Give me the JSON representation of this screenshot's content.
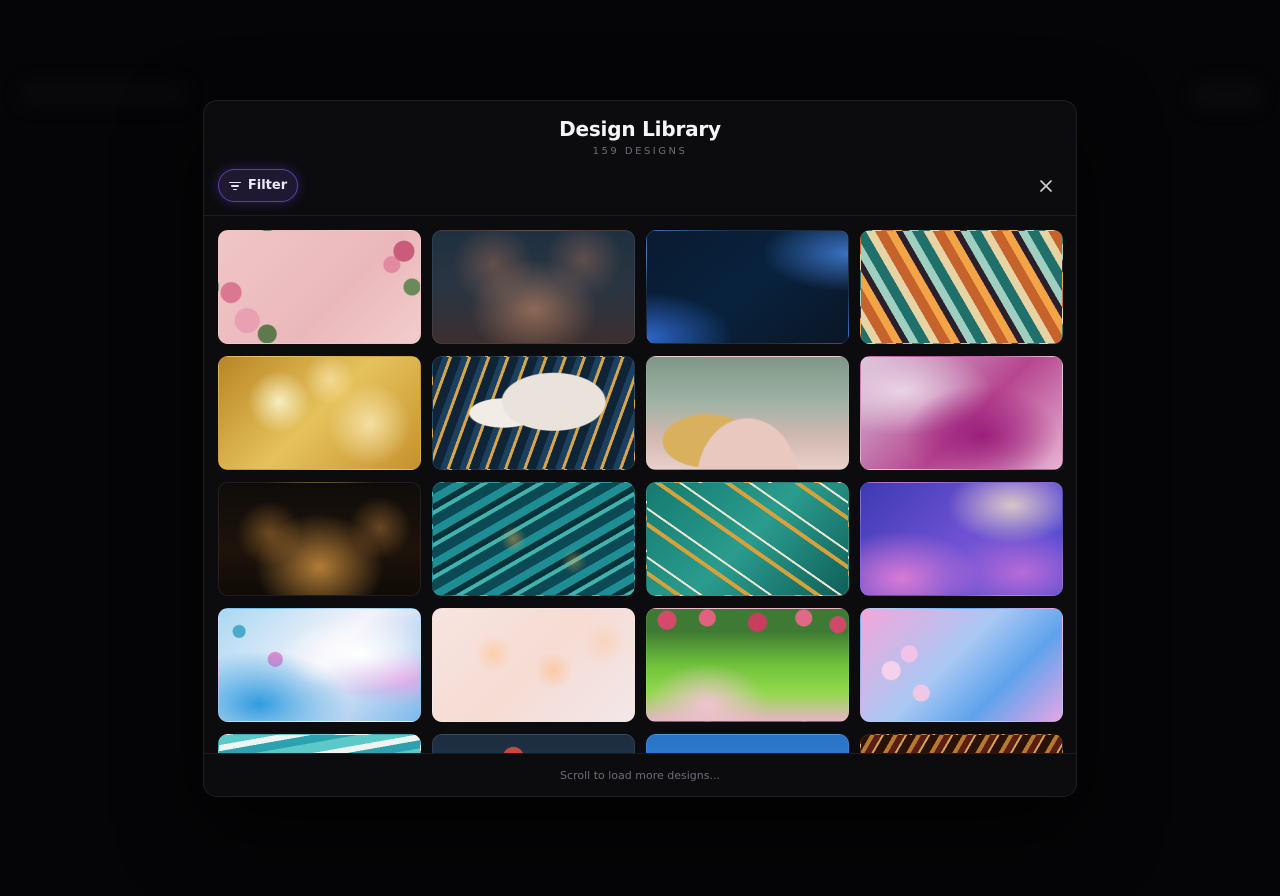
{
  "modal": {
    "title": "Design Library",
    "subtitle": "159 DESIGNS",
    "filter_label": "Filter",
    "footer_text": "Scroll to load more designs..."
  },
  "colors": {
    "accent": "#6b4ed6",
    "modal_background": "#0c0c0f",
    "page_background": "#050507"
  },
  "icons": {
    "filter": "filter-lines-icon",
    "close": "close-x-icon"
  }
}
